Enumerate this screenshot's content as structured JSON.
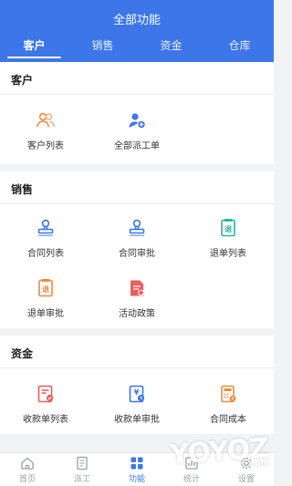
{
  "header": {
    "title": "全部功能"
  },
  "tabs": [
    {
      "label": "客户"
    },
    {
      "label": "销售"
    },
    {
      "label": "资金"
    },
    {
      "label": "仓库"
    }
  ],
  "sections": [
    {
      "title": "客户",
      "items": [
        {
          "label": "客户列表",
          "icon": "people-icon"
        },
        {
          "label": "全部派工单",
          "icon": "user-add-icon"
        }
      ]
    },
    {
      "title": "销售",
      "items": [
        {
          "label": "合同列表",
          "icon": "stamp-icon"
        },
        {
          "label": "合同审批",
          "icon": "stamp-icon"
        },
        {
          "label": "退单列表",
          "icon": "return-doc-icon"
        },
        {
          "label": "退单审批",
          "icon": "return-doc-icon"
        },
        {
          "label": "活动政策",
          "icon": "policy-doc-icon"
        }
      ]
    },
    {
      "title": "资金",
      "items": [
        {
          "label": "收款单列表",
          "icon": "receipt-icon"
        },
        {
          "label": "收款单审批",
          "icon": "receipt-approve-icon"
        },
        {
          "label": "合同成本",
          "icon": "calculator-icon"
        }
      ]
    }
  ],
  "tabbar": [
    {
      "label": "首页",
      "icon": "home-icon"
    },
    {
      "label": "派工",
      "icon": "document-icon"
    },
    {
      "label": "功能",
      "icon": "grid-icon"
    },
    {
      "label": "统计",
      "icon": "chart-icon"
    },
    {
      "label": "设置",
      "icon": "gear-icon"
    }
  ],
  "watermark": {
    "text": "YOYOZ",
    "sub": ".com"
  },
  "colors": {
    "primary": "#3c76e9",
    "orange": "#f08a3c",
    "red": "#ef5c5c",
    "teal": "#2bb3a7"
  }
}
